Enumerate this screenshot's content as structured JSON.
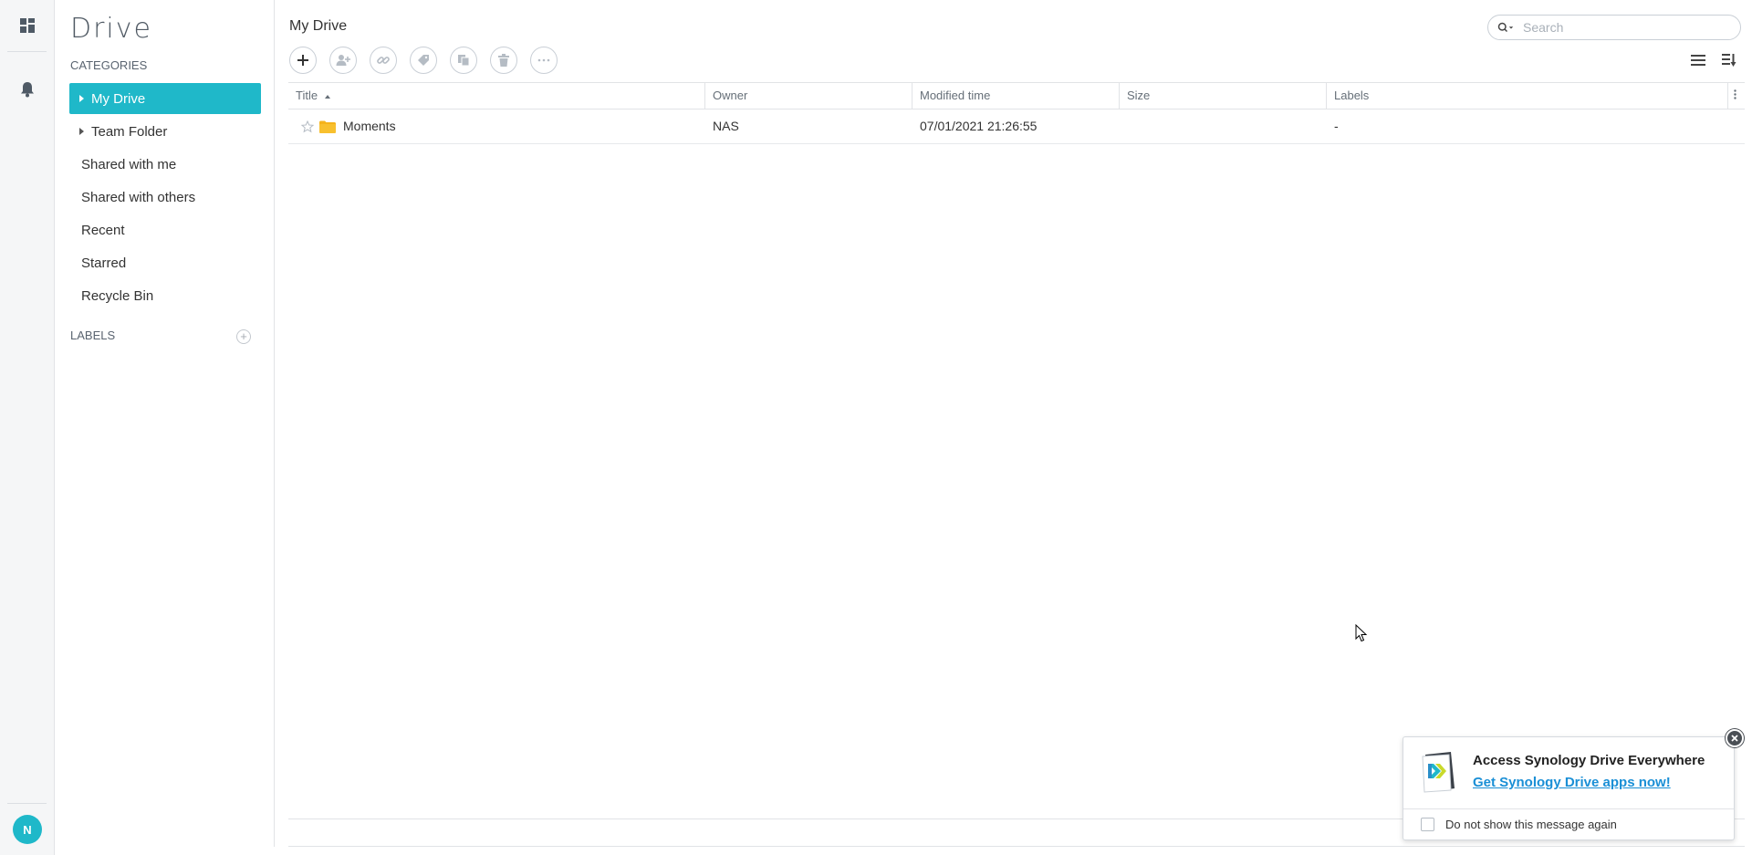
{
  "app": {
    "logo_text": "Drive"
  },
  "sidebar": {
    "categories_title": "CATEGORIES",
    "items": [
      {
        "label": "My Drive",
        "active": true,
        "expandable": true
      },
      {
        "label": "Team Folder",
        "active": false,
        "expandable": true
      },
      {
        "label": "Shared with me"
      },
      {
        "label": "Shared with others"
      },
      {
        "label": "Recent"
      },
      {
        "label": "Starred"
      },
      {
        "label": "Recycle Bin"
      }
    ],
    "labels_title": "LABELS"
  },
  "user": {
    "avatar_initial": "N"
  },
  "main": {
    "title": "My Drive",
    "search": {
      "placeholder": "Search"
    },
    "toolbar": [
      "add-icon",
      "share-user-icon",
      "link-icon",
      "label-icon",
      "copy-icon",
      "delete-icon",
      "more-icon"
    ]
  },
  "table": {
    "columns": [
      "Title",
      "Owner",
      "Modified time",
      "Size",
      "Labels"
    ],
    "sort": {
      "column": "Title",
      "direction": "asc"
    },
    "rows": [
      {
        "title": "Moments",
        "owner": "NAS",
        "modified": "07/01/2021 21:26:55",
        "size": "",
        "labels": "-"
      }
    ]
  },
  "notification": {
    "title": "Access Synology Drive Everywhere",
    "link": "Get Synology Drive apps now!",
    "checkbox_label": "Do not show this message again"
  },
  "colors": {
    "accent": "#1fb8c9",
    "folder": "#f5b31b",
    "link": "#1a8fd6"
  }
}
